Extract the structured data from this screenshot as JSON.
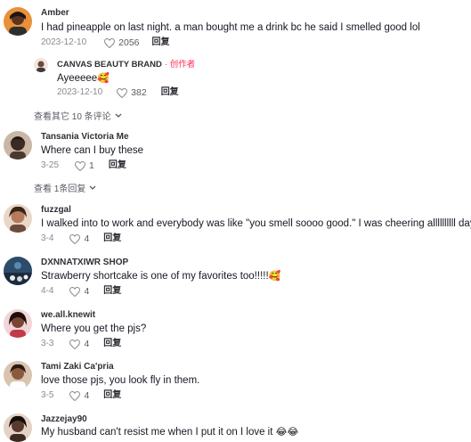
{
  "comments": [
    {
      "name": "Amber",
      "text": "I had pineapple on last night. a man bought me a drink bc he said I smelled good lol",
      "date": "2023-12-10",
      "likes": "2056",
      "reply_label": "回复",
      "avatar_color": "#e8913a",
      "reply": {
        "name": "CANVAS BEAUTY BRAND",
        "author_tag": "· 创作者",
        "text": "Ayeeeee",
        "emoji": "🥰",
        "date": "2023-12-10",
        "likes": "382",
        "reply_label": "回复"
      },
      "view_more": "查看其它 10 条评论"
    },
    {
      "name": "Tansania Victoria Me",
      "text": "Where can I buy these",
      "date": "3-25",
      "likes": "1",
      "reply_label": "回复",
      "avatar_color": "#3b2a22",
      "view_more": "查看 1条回复"
    },
    {
      "name": "fuzzgal",
      "text": "I walked into to work and everybody was like \"you smell soooo good.\" I was cheering allllllllll day",
      "date": "3-4",
      "likes": "4",
      "reply_label": "回复",
      "avatar_color": "#b77a5c"
    },
    {
      "name": "DXNNATXIWR SHOP",
      "text": "Strawberry shortcake is one of my favorites too!!!!!",
      "emoji": "🥰",
      "date": "4-4",
      "likes": "4",
      "reply_label": "回复",
      "avatar_color": "#2d4b6b"
    },
    {
      "name": "we.all.knewit",
      "text": "Where you get the pjs?",
      "date": "3-3",
      "likes": "4",
      "reply_label": "回复",
      "avatar_color": "#c23a4a"
    },
    {
      "name": "Tami Zaki Ca'pria",
      "text": "love those pjs, you look fly in them.",
      "date": "3-5",
      "likes": "4",
      "reply_label": "回复",
      "avatar_color": "#8b5a3c"
    },
    {
      "name": "Jazzejay90",
      "text": "My husband can't resist me when I put it on I love it ",
      "emoji": "😂😂",
      "avatar_color": "#5a3a2e"
    }
  ],
  "colors": {
    "author_tag": "#fe2c55",
    "meta": "#8a8b91",
    "text": "#161823"
  }
}
